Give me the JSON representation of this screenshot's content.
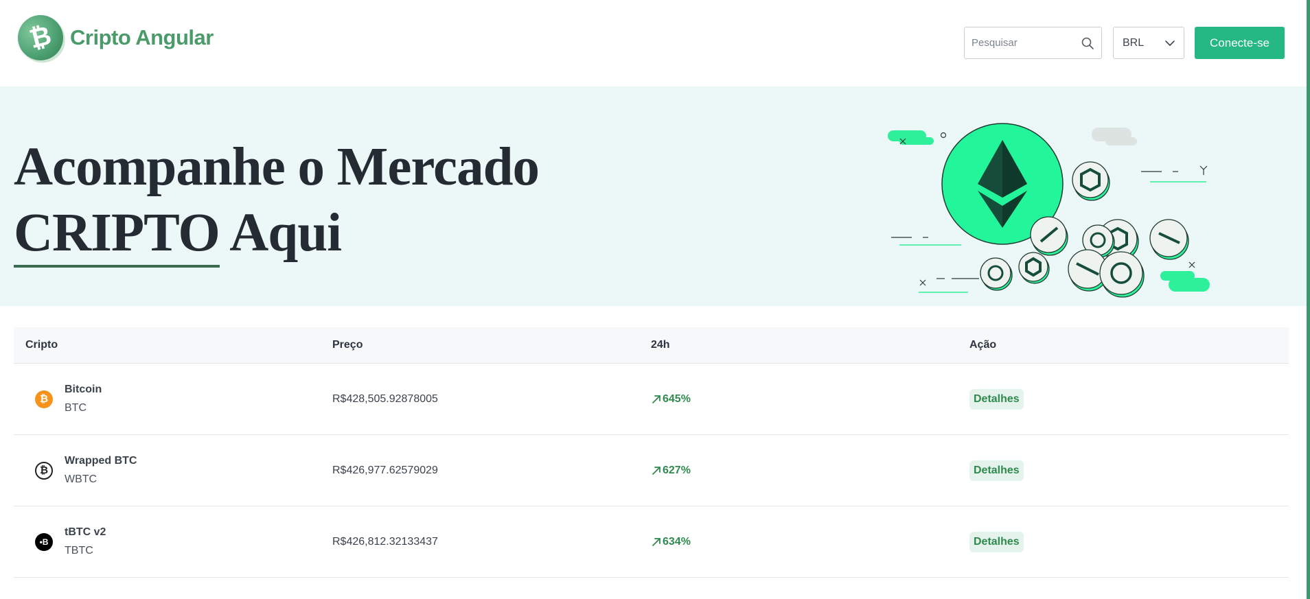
{
  "header": {
    "brand": {
      "logo_glyph": "₿",
      "name": "Cripto Angular"
    },
    "search": {
      "placeholder": "Pesquisar",
      "value": ""
    },
    "currency": {
      "selected": "BRL"
    },
    "connect_label": "Conecte-se"
  },
  "hero": {
    "title_line1": "Acompanhe o Mercado",
    "title_highlight": "CRIPTO",
    "title_line2_rest": " Aqui"
  },
  "table": {
    "headers": {
      "coin": "Cripto",
      "price": "Preço",
      "change": "24h",
      "action": "Ação"
    },
    "rows": [
      {
        "name": "Bitcoin",
        "symbol": "BTC",
        "price": "R$428,505.92878005",
        "change": "645%",
        "action": "Detalhes",
        "icon": "bitcoin-icon",
        "icon_glyph": "₿",
        "icon_color": "#f7931a"
      },
      {
        "name": "Wrapped BTC",
        "symbol": "WBTC",
        "price": "R$426,977.62579029",
        "change": "627%",
        "action": "Detalhes",
        "icon": "wrapped-btc-icon",
        "icon_glyph": "₿",
        "icon_color": "#ffffff"
      },
      {
        "name": "tBTC v2",
        "symbol": "TBTC",
        "price": "R$426,812.32133437",
        "change": "634%",
        "action": "Detalhes",
        "icon": "tbtc-icon",
        "icon_glyph": "•B",
        "icon_color": "#000000"
      }
    ]
  },
  "colors": {
    "accent": "#26b882",
    "brand_text": "#4a9a6a",
    "hero_bg": "#ecf7f7",
    "positive": "#2f8a4d"
  }
}
